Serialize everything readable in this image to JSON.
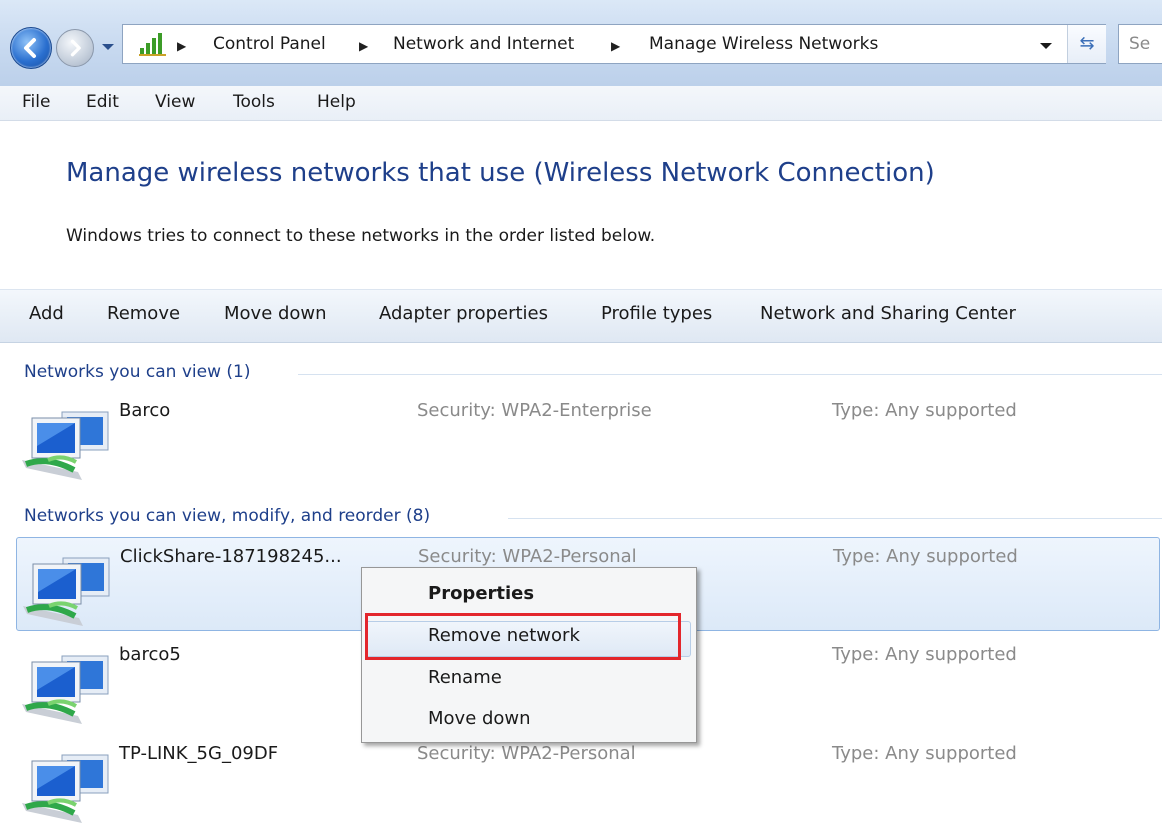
{
  "address_bar": {
    "breadcrumbs": [
      "Control Panel",
      "Network and Internet",
      "Manage Wireless Networks"
    ],
    "search_placeholder": "Se"
  },
  "menu": [
    "File",
    "Edit",
    "View",
    "Tools",
    "Help"
  ],
  "heading": {
    "title": "Manage wireless networks that use (Wireless Network Connection)",
    "subtitle": "Windows tries to connect to these networks in the order listed below."
  },
  "toolbar": [
    "Add",
    "Remove",
    "Move down",
    "Adapter properties",
    "Profile types",
    "Network and Sharing Center"
  ],
  "groups": [
    {
      "header": "Networks you can view (1)",
      "networks": [
        {
          "name": "Barco",
          "security": "Security:  WPA2-Enterprise",
          "type": "Type:  Any supported"
        }
      ]
    },
    {
      "header": "Networks you can view, modify, and reorder (8)",
      "networks": [
        {
          "name": "ClickShare-187198245...",
          "security": "Security:  WPA2-Personal",
          "type": "Type:  Any supported"
        },
        {
          "name": "barco5",
          "security": "",
          "type": "Type:  Any supported"
        },
        {
          "name": "TP-LINK_5G_09DF",
          "security": "Security:  WPA2-Personal",
          "type": "Type:  Any supported"
        }
      ]
    }
  ],
  "context_menu": [
    "Properties",
    "Remove network",
    "Rename",
    "Move down"
  ],
  "colors": {
    "heading_blue": "#1e3f8a",
    "selection_border": "#8fb5e3",
    "highlight_red": "#e3262c"
  },
  "icons": [
    "back-arrow-icon",
    "forward-arrow-icon",
    "network-bars-icon",
    "refresh-icon",
    "wireless-network-icon"
  ]
}
